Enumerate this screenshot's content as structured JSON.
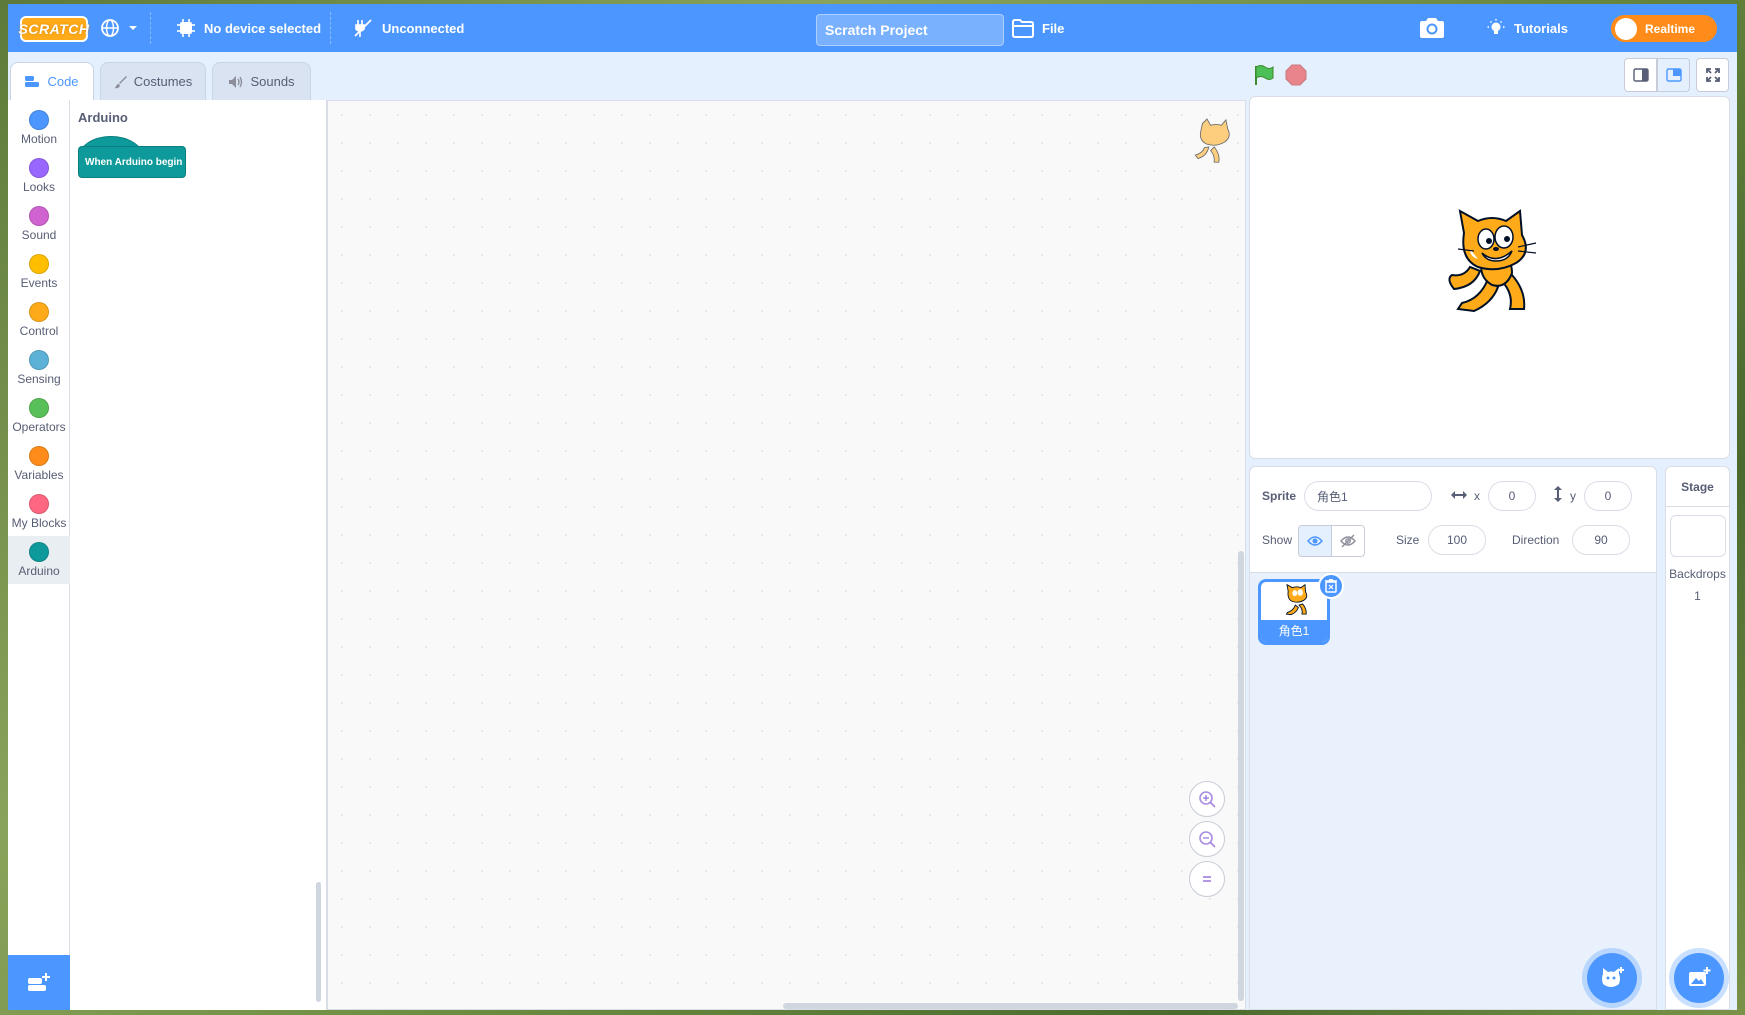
{
  "menubar": {
    "logo": "SCRATCH",
    "device": "No device selected",
    "connection": "Unconnected",
    "project_title": "Scratch Project",
    "file": "File",
    "tutorials": "Tutorials",
    "realtime": "Realtime"
  },
  "tabs": [
    {
      "label": "Code",
      "icon": "code-icon"
    },
    {
      "label": "Costumes",
      "icon": "brush-icon"
    },
    {
      "label": "Sounds",
      "icon": "speaker-icon"
    }
  ],
  "categories": [
    {
      "label": "Motion",
      "color": "#4c97ff"
    },
    {
      "label": "Looks",
      "color": "#9966ff"
    },
    {
      "label": "Sound",
      "color": "#cf63cf"
    },
    {
      "label": "Events",
      "color": "#ffbf00"
    },
    {
      "label": "Control",
      "color": "#ffab19"
    },
    {
      "label": "Sensing",
      "color": "#5cb1d6"
    },
    {
      "label": "Operators",
      "color": "#59c059"
    },
    {
      "label": "Variables",
      "color": "#ff8c1a"
    },
    {
      "label": "My Blocks",
      "color": "#ff6680"
    },
    {
      "label": "Arduino",
      "color": "#0e9a9a"
    }
  ],
  "palette": {
    "title": "Arduino",
    "block": "When Arduino begin"
  },
  "sprite_info": {
    "sprite_label": "Sprite",
    "sprite_name": "角色1",
    "x_label": "x",
    "x_value": "0",
    "y_label": "y",
    "y_value": "0",
    "show_label": "Show",
    "size_label": "Size",
    "size_value": "100",
    "direction_label": "Direction",
    "direction_value": "90"
  },
  "sprite_tile": {
    "name": "角色1"
  },
  "stage_pane": {
    "title": "Stage",
    "backdrops_label": "Backdrops",
    "backdrops_count": "1"
  },
  "colors": {
    "accent": "#4c97ff",
    "realtime": "#ff8c1a",
    "arduino": "#0e9a9a"
  }
}
